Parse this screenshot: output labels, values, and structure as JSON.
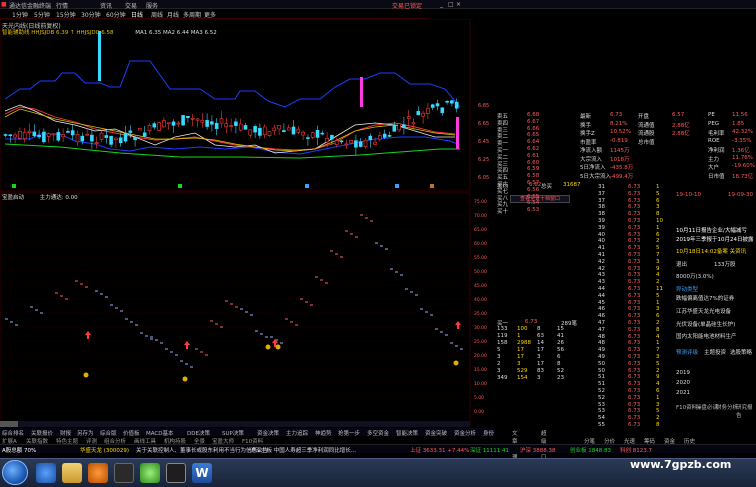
{
  "menu": {
    "app_title": "通达信金融终端",
    "items": [
      "行情",
      "资讯",
      "交易",
      "服务"
    ],
    "trade_link": "交易已锁定"
  },
  "toolbar": {
    "periods": [
      "1分钟",
      "5分钟",
      "15分钟",
      "30分钟",
      "60分钟",
      "日线",
      "周线",
      "月线",
      "多周期",
      "更多"
    ],
    "main_indicator": "天光内线(日线前复权)",
    "indicator_line": "智能辅助线 HHJSJDB 6.39  ↑ HHJSJDC 6.58",
    "ma_line": "MA1 6.35  MA2 6.44  MA3 6.52",
    "sub_indicator_name": "宝盈启动",
    "sub_indicator_value": "主力通达: 0.00"
  },
  "price_axis": [
    "6.85",
    "6.65",
    "6.45",
    "6.25",
    "6.05"
  ],
  "sub_axis": [
    "75.00",
    "70.00",
    "65.00",
    "60.00",
    "55.00",
    "50.00",
    "45.00",
    "40.00",
    "35.00",
    "30.00",
    "25.00",
    "20.00",
    "15.00",
    "10.00",
    "5.00",
    "0.00"
  ],
  "overlay_label": "查看全景十档窗口",
  "orderbook": {
    "sell": [
      {
        "label": "卖五",
        "price": "6.68"
      },
      {
        "label": "卖四",
        "price": "6.67"
      },
      {
        "label": "卖三",
        "price": "6.66"
      },
      {
        "label": "卖二",
        "price": "6.65"
      },
      {
        "label": "卖一",
        "price": "6.64"
      },
      {
        "label": "买一",
        "price": "6.62"
      },
      {
        "label": "买二",
        "price": "6.61"
      },
      {
        "label": "买三",
        "price": "6.60"
      },
      {
        "label": "买四",
        "price": "6.59"
      },
      {
        "label": "买五",
        "price": "6.58"
      },
      {
        "label": "买六",
        "price": "6.57"
      },
      {
        "label": "买七",
        "price": "6.56"
      },
      {
        "label": "买八",
        "price": "6.55"
      },
      {
        "label": "买九",
        "price": "6.54"
      },
      {
        "label": "买十",
        "price": "6.53"
      }
    ],
    "summary_buy": "6.62",
    "summary_total": "总卖",
    "summary_volume": "31687",
    "summary_label2": "总买"
  },
  "stats": [
    {
      "a": "最新",
      "b": "6.73",
      "c": "开盘",
      "d": "6.57",
      "e": "PE",
      "f": "11.56"
    },
    {
      "a": "换手",
      "b": "8.21%",
      "c": "流通值",
      "d": "2.88亿",
      "e": "PEG",
      "f": "1.85"
    },
    {
      "a": "换手Z",
      "b": "10.52%",
      "c": "流通股",
      "d": "2.88亿",
      "e": "毛利率",
      "f": "42.32%"
    },
    {
      "a": "市盈率",
      "b": "-0.819",
      "c": "总市值",
      "d": "",
      "e": "ROE",
      "f": "-3.35%"
    },
    {
      "a": "净流入额",
      "b": "1145万",
      "c": "",
      "d": "",
      "e": "净利润",
      "f": "1.36亿"
    },
    {
      "a": "大宗流入",
      "b": "1018万",
      "c": "",
      "d": "",
      "e": "主力",
      "f": "11.76%"
    },
    {
      "a": "5日净流入",
      "b": "-435.8万",
      "c": "",
      "d": "",
      "e": "大户",
      "f": "-19.60%"
    },
    {
      "a": "5日大宗流入",
      "b": "-499.4万",
      "c": "",
      "d": "",
      "e": "日市值",
      "f": "18.73亿"
    }
  ],
  "ticks": [
    {
      "t": "31",
      "p": "6.73",
      "v": "1"
    },
    {
      "t": "37",
      "p": "6.73",
      "v": "5"
    },
    {
      "t": "37",
      "p": "6.73",
      "v": "6"
    },
    {
      "t": "38",
      "p": "6.73",
      "v": "3"
    },
    {
      "t": "38",
      "p": "6.73",
      "v": "8"
    },
    {
      "t": "39",
      "p": "6.73",
      "v": "10"
    },
    {
      "t": "39",
      "p": "6.73",
      "v": "1"
    },
    {
      "t": "40",
      "p": "6.73",
      "v": "6"
    },
    {
      "t": "40",
      "p": "6.73",
      "v": "2"
    },
    {
      "t": "41",
      "p": "6.73",
      "v": "5"
    },
    {
      "t": "41",
      "p": "6.73",
      "v": "7"
    },
    {
      "t": "42",
      "p": "6.73",
      "v": "3"
    },
    {
      "t": "42",
      "p": "6.73",
      "v": "9"
    },
    {
      "t": "43",
      "p": "6.73",
      "v": "4"
    },
    {
      "t": "43",
      "p": "6.73",
      "v": "2"
    },
    {
      "t": "44",
      "p": "6.73",
      "v": "11"
    },
    {
      "t": "44",
      "p": "6.73",
      "v": "5"
    },
    {
      "t": "45",
      "p": "6.73",
      "v": "1"
    },
    {
      "t": "46",
      "p": "6.73",
      "v": "3"
    },
    {
      "t": "46",
      "p": "6.73",
      "v": "6"
    },
    {
      "t": "47",
      "p": "6.73",
      "v": "2"
    },
    {
      "t": "47",
      "p": "6.73",
      "v": "8"
    },
    {
      "t": "48",
      "p": "6.73",
      "v": "4"
    },
    {
      "t": "48",
      "p": "6.73",
      "v": "1"
    },
    {
      "t": "49",
      "p": "6.73",
      "v": "7"
    },
    {
      "t": "49",
      "p": "6.73",
      "v": "3"
    },
    {
      "t": "50",
      "p": "6.73",
      "v": "5"
    },
    {
      "t": "50",
      "p": "6.73",
      "v": "2"
    },
    {
      "t": "51",
      "p": "6.73",
      "v": "9"
    },
    {
      "t": "51",
      "p": "6.73",
      "v": "4"
    },
    {
      "t": "52",
      "p": "6.73",
      "v": "6"
    },
    {
      "t": "52",
      "p": "6.73",
      "v": "1"
    },
    {
      "t": "53",
      "p": "6.73",
      "v": "3"
    },
    {
      "t": "53",
      "p": "6.73",
      "v": "5"
    },
    {
      "t": "54",
      "p": "6.73",
      "v": "2"
    },
    {
      "t": "55",
      "p": "6.73",
      "v": "8"
    }
  ],
  "order_detail": {
    "header": [
      "买一",
      "6.73",
      "289笔"
    ],
    "rows": [
      [
        "133",
        "100",
        "8",
        "15"
      ],
      [
        "119",
        "1",
        "63",
        "41"
      ],
      [
        "158",
        "2988",
        "14",
        "26"
      ],
      [
        "5",
        "17",
        "17",
        "56"
      ],
      [
        "3",
        "17",
        "3",
        "6"
      ],
      [
        "2",
        "3",
        "17",
        "8"
      ],
      [
        "3",
        "529",
        "83",
        "52"
      ],
      [
        "349",
        "154",
        "3",
        "23"
      ]
    ]
  },
  "news": {
    "date1": "19-10-10",
    "date2": "19-09-30",
    "item1": "10月11日报告企业/大幅减亏",
    "item2": "2019年三季报于10月24日披露",
    "item3": "10月18日14:02备案 关资讯",
    "label_zone": "退出",
    "count": "133万股",
    "value": "8000万(3.0%)",
    "sector_title": "异动类型",
    "sectors": [
      "跌幅偏离值达7%的证券",
      "江苏华盛天龙光电设备",
      "光伏设备(单晶硅生长炉)",
      "国内太阳能电池材料生产"
    ],
    "tabs": [
      "预测评级",
      "主题投资",
      "选股策略"
    ],
    "years": [
      "2019",
      "2020",
      "2021"
    ],
    "footer_tabs": [
      "F10资料",
      "操盘必读",
      "财务分析",
      "研究报告"
    ]
  },
  "bottom_tabs": [
    "综合排名",
    "关联报价",
    "财报",
    "另存为",
    "综合版",
    "价值板",
    "MACD基本",
    "DDE决策",
    "SUP决策",
    "资金决策",
    "主力追踪",
    "神趋势",
    "抢第一步",
    "多空资金",
    "智能决策",
    "资金突破",
    "资金分析",
    "身份证码",
    "文章管理",
    "超级盘口"
  ],
  "tabs2": [
    "扩展A",
    "关联指数",
    "特色主题",
    "评测",
    "组合分析",
    "画线工具",
    "机构持股",
    "全景",
    "宝盈大师",
    "F10资料"
  ],
  "right_tabs": [
    "分笔",
    "分价",
    "光速",
    "筹码",
    "资金",
    "历史"
  ],
  "ticker": {
    "items": [
      "A股总额 70%",
      "华盛天龙 (300029)",
      "关于关联控制人、董事长或股东利用不当行为信息公告",
      "沪深主板 中国人寿超三季净利润同比增长...",
      "上证 3633.31 +7.44%",
      "深证 11111.41",
      "沪深 3888.38",
      "创业板 1848.83",
      "科创 8123.7"
    ]
  },
  "watermark": "www.7gpzb.com"
}
